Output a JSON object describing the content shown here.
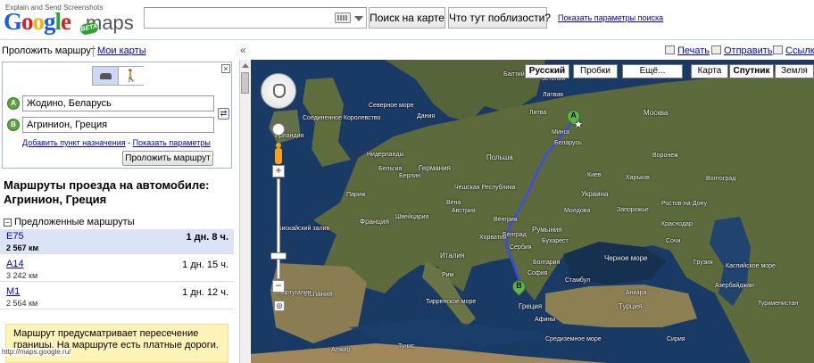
{
  "header": {
    "logo_tagline": "Explain and Send Screenshots",
    "logo_main": "Google",
    "logo_maps": "maps",
    "logo_beta": "BETA",
    "search_value": "",
    "search_map_label": "Поиск на карте",
    "whats_nearby_label": "Что тут поблизости?",
    "search_options_label": "Показать параметры поиска"
  },
  "tabs": {
    "directions": "Проложить маршрут",
    "my_maps": "Мои карты",
    "collapse": "«"
  },
  "map_actions": {
    "print": "Печать",
    "send": "Отправить",
    "link": "Ссылка"
  },
  "route_form": {
    "from_marker": "A",
    "to_marker": "B",
    "from_value": "Жодино, Беларусь",
    "to_value": "Агринион, Греция",
    "add_destination": "Добавить пункт назначения",
    "separator": "-",
    "show_options": "Показать параметры",
    "submit_label": "Проложить маршрут",
    "walk_glyph": "🚶",
    "close_glyph": "×",
    "reverse_glyph": "⇄"
  },
  "results": {
    "title": "Маршруты проезда на автомобиле: Агринион, Греция",
    "suggested_header": "Предложенные маршруты",
    "collapse_glyph": "−",
    "routes": [
      {
        "name": "E75",
        "distance": "2 567 км",
        "time": "1 дн. 8 ч."
      },
      {
        "name": "A14",
        "distance": "3 242 км",
        "time": "1 дн. 15 ч."
      },
      {
        "name": "M1",
        "distance": "2 564 км",
        "time": "1 дн. 12 ч."
      }
    ],
    "warning": "Маршрут предусматривает пересечение границы. На маршруте есть платные дороги."
  },
  "status_bar_url": "http://maps.google.ru/",
  "map": {
    "type_buttons": {
      "russian": "Русский",
      "traffic": "Пробки",
      "more": "Ещё...",
      "map": "Карта",
      "satellite": "Спутник",
      "terrain": "Земля"
    },
    "zoom_in": "+",
    "zoom_out": "−",
    "overview_glyph": "◎",
    "marker_a": "A",
    "marker_b": "B",
    "star": "★",
    "labels": {
      "baltic_sea": "Балтийское море",
      "north_sea": "Северное море",
      "uk": "Соединенное Королевство",
      "ireland": "Ирландия",
      "netherlands": "Нидерланды",
      "denmark": "Дания",
      "belgium": "Бельгия",
      "germany": "Германия",
      "poland": "Польша",
      "czech": "Чешская Республика",
      "france": "Франция",
      "switzerland": "Швейцария",
      "austria": "Австрия",
      "hungary": "Венгрия",
      "romania": "Румыния",
      "moldova": "Молдова",
      "ukraine": "Украина",
      "belarus": "Беларусь",
      "lithuania": "Литва",
      "latvia": "Латвия",
      "estonia": "Эстония",
      "minsk": "Минск",
      "kyiv": "Киев",
      "moscow": "Москва",
      "voronezh": "Воронеж",
      "kharkiv": "Харьков",
      "zaporizhzhia": "Запорожье",
      "rostov": "Ростов-на-Дону",
      "volgograd": "Волгоград",
      "italy": "Италия",
      "spain": "Испания",
      "portugal": "Португалия",
      "croatia": "Хорватия",
      "serbia": "Сербия",
      "bulgaria": "Болгария",
      "greece": "Греция",
      "turkey": "Турция",
      "black_sea": "Черное море",
      "caspian_sea": "Каспийское море",
      "mediterranean": "Средиземное море",
      "tyrrhenian": "Тирренское море",
      "biscay": "Бискайский залив",
      "tunisia": "Тунис",
      "algeria": "Алжир",
      "georgia": "Грузия",
      "azerbaijan": "Азербайджан",
      "turkmenistan": "Туркменистан",
      "syria": "Сирия",
      "rome": "Рим",
      "paris": "Париж",
      "berlin": "Берлин",
      "vienna": "Вена",
      "bucharest": "Бухарест",
      "istanbul": "Стамбул",
      "athens": "Афины",
      "ankara": "Анкара",
      "sofia": "София",
      "belgrade": "Белград",
      "krasnodar": "Краснодар",
      "sochi": "Сочи"
    }
  },
  "colors": {
    "link": "#0000cc",
    "selected_route_bg": "#dbe4f7",
    "warning_bg": "#fff3b8",
    "route_line": "#3b4fe0",
    "marker_green": "#62b24b",
    "sea": "#1a3a66",
    "land": "#5e6b3c"
  }
}
